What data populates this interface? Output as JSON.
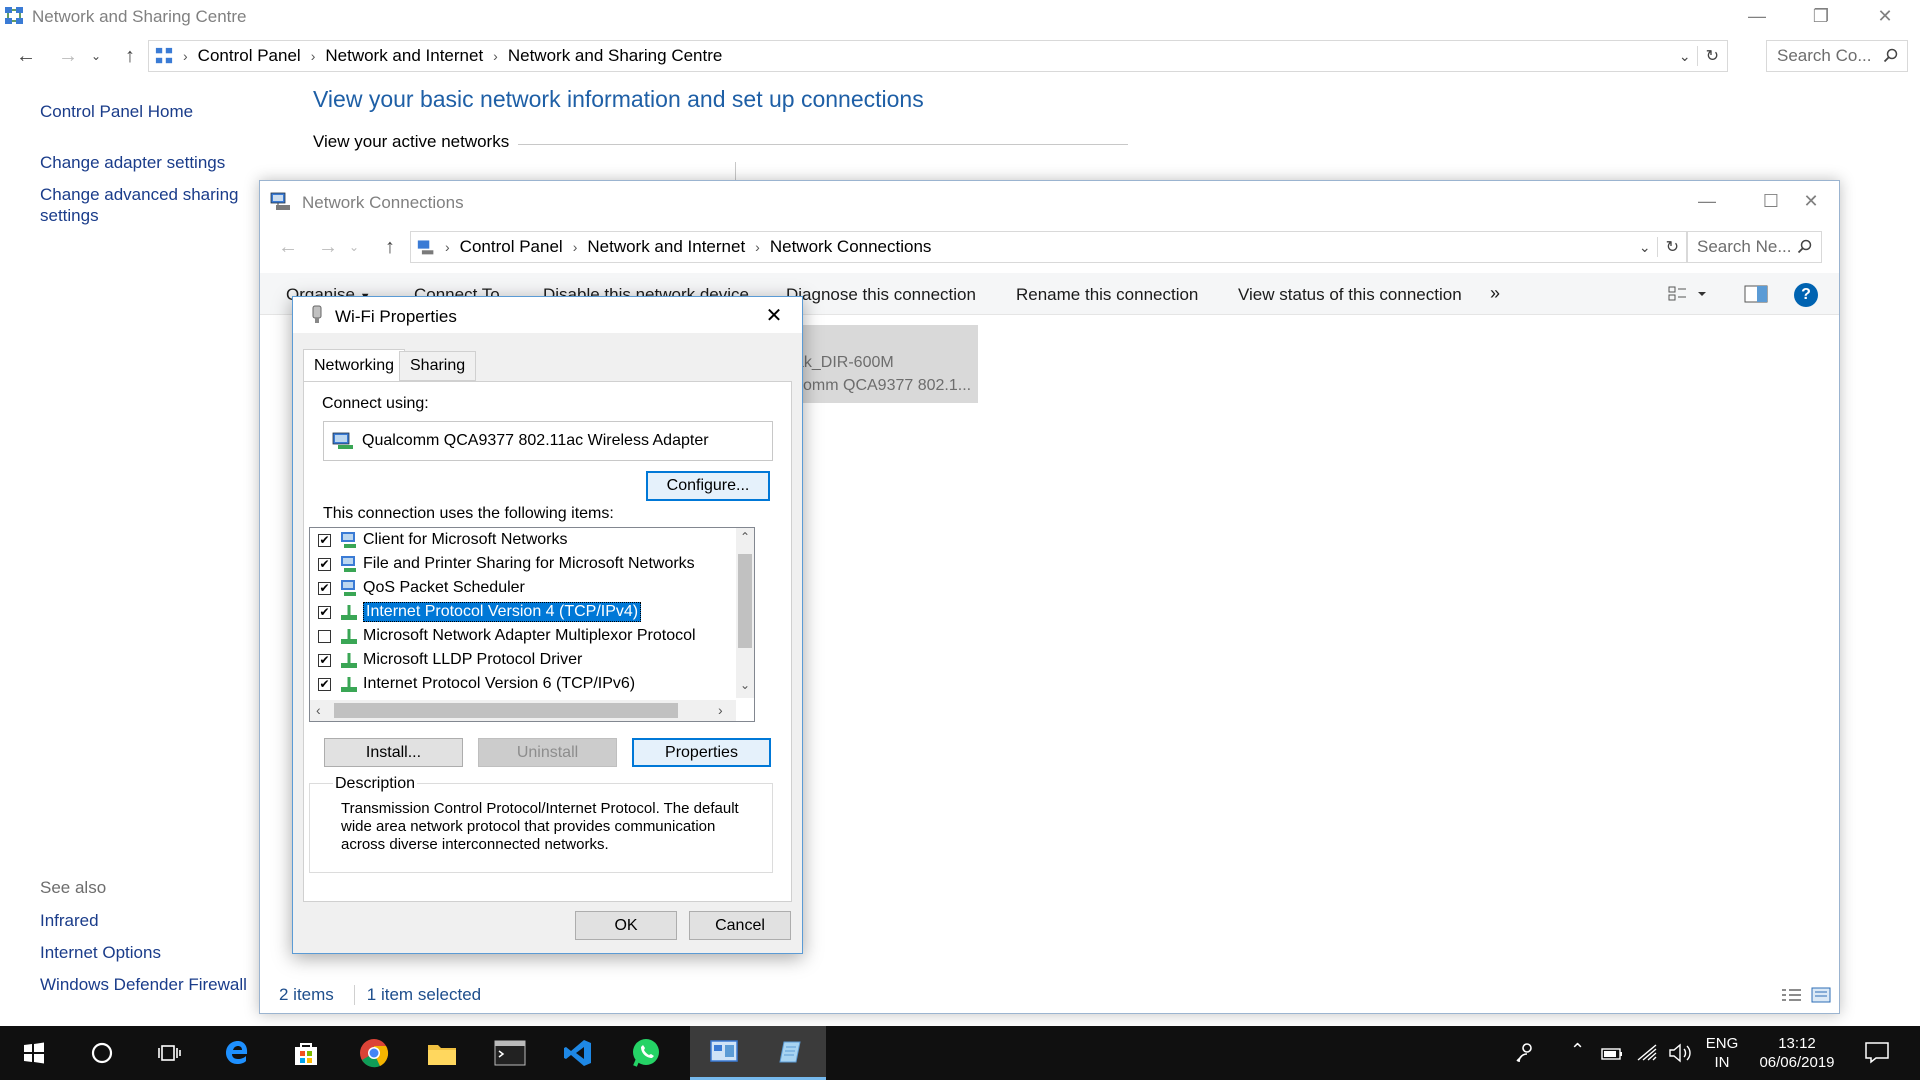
{
  "main_window": {
    "title": "Network and Sharing Centre",
    "breadcrumbs": [
      "Control Panel",
      "Network and Internet",
      "Network and Sharing Centre"
    ],
    "search_placeholder": "Search Co...",
    "heading": "View your basic network information and set up connections",
    "active_networks_label": "View your active networks"
  },
  "sidebar": {
    "links": [
      "Control Panel Home",
      "Change adapter settings",
      "Change advanced sharing settings"
    ],
    "see_also_label": "See also",
    "see_also": [
      "Infrared",
      "Internet Options",
      "Windows Defender Firewall"
    ]
  },
  "nc_window": {
    "title": "Network Connections",
    "breadcrumbs": [
      "Control Panel",
      "Network and Internet",
      "Network Connections"
    ],
    "search_placeholder": "Search Ne...",
    "toolbar": {
      "organise": "Organise",
      "connect_to": "Connect To",
      "disable": "Disable this network device",
      "diagnose": "Diagnose this connection",
      "rename": "Rename this connection",
      "view_status": "View status of this connection",
      "more": "»"
    },
    "adapter": {
      "line1": "ak_DIR-600M",
      "line2": "comm QCA9377 802.1..."
    },
    "status": {
      "items": "2 items",
      "selected": "1 item selected"
    }
  },
  "wifi_dialog": {
    "title": "Wi-Fi Properties",
    "tabs": [
      "Networking",
      "Sharing"
    ],
    "connect_using_label": "Connect using:",
    "adapter_name": "Qualcomm QCA9377 802.11ac Wireless Adapter",
    "configure_button": "Configure...",
    "items_label": "This connection uses the following items:",
    "items": [
      {
        "label": "Client for Microsoft Networks",
        "checked": true
      },
      {
        "label": "File and Printer Sharing for Microsoft Networks",
        "checked": true
      },
      {
        "label": "QoS Packet Scheduler",
        "checked": true
      },
      {
        "label": "Internet Protocol Version 4 (TCP/IPv4)",
        "checked": true,
        "selected": true
      },
      {
        "label": "Microsoft Network Adapter Multiplexor Protocol",
        "checked": false
      },
      {
        "label": "Microsoft LLDP Protocol Driver",
        "checked": true
      },
      {
        "label": "Internet Protocol Version 6 (TCP/IPv6)",
        "checked": true
      }
    ],
    "install_button": "Install...",
    "uninstall_button": "Uninstall",
    "properties_button": "Properties",
    "description_label": "Description",
    "description_text": "Transmission Control Protocol/Internet Protocol. The default wide area network protocol that provides communication across diverse interconnected networks.",
    "ok_button": "OK",
    "cancel_button": "Cancel"
  },
  "taskbar": {
    "apps": [
      "start-icon",
      "cortana-icon",
      "task-view-icon",
      "edge-icon",
      "store-icon",
      "chrome-icon",
      "file-explorer-icon",
      "terminal-icon",
      "vscode-icon",
      "whatsapp-icon",
      "control-panel-icon",
      "notepad-icon"
    ],
    "lang_line1": "ENG",
    "lang_line2": "IN",
    "time": "13:12",
    "date": "06/06/2019"
  },
  "colors": {
    "link": "#1a3c8a",
    "heading": "#1e5fa6",
    "accent": "#0078d7",
    "taskbar": "#101010"
  }
}
